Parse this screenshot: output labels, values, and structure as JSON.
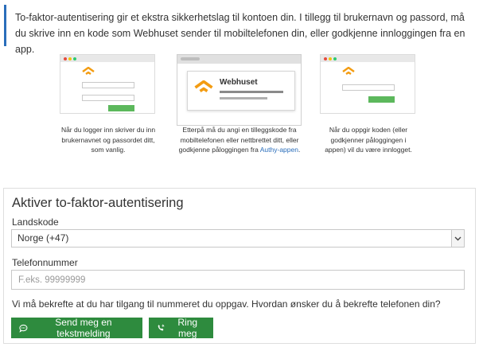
{
  "intro": {
    "text": "To-faktor-autentisering gir et ekstra sikkerhetslag til kontoen din. I tillegg til brukernavn og passord, må du skrive inn en kode som Webhuset sender til mobiltelefonen din, eller godkjenne innloggingen fra en app."
  },
  "steps": [
    {
      "caption": "Når du logger inn skriver du inn brukernavnet og passordet ditt, som vanlig."
    },
    {
      "caption": "Etterpå må du angi en tilleggskode fra mobiltelefonen eller nettbrettet ditt, eller godkjenne påloggingen fra",
      "link": "Authy-appen",
      "after": ".",
      "brand": "Webhuset"
    },
    {
      "caption": "Når du oppgir koden (eller godkjenner påloggingen i appen) vil du være innlogget."
    }
  ],
  "form": {
    "title": "Aktiver to-faktor-autentisering",
    "country_label": "Landskode",
    "country_value": "Norge (+47)",
    "phone_label": "Telefonnummer",
    "phone_placeholder": "F.eks. 99999999",
    "question": "Vi må bekrefte at du har tilgang til nummeret du oppgav. Hvordan ønsker du å bekrefte telefonen din?",
    "sms_button": "Send meg en tekstmelding",
    "call_button": "Ring meg"
  },
  "icons": {
    "chat": "chat-bubble-icon",
    "phone": "phone-ring-icon",
    "chevron": "chevron-down-icon",
    "logo": "webhuset-logo-icon"
  },
  "colors": {
    "accent": "#2a6ebb",
    "logo": "#f39c12",
    "button": "#2e8b3e"
  }
}
